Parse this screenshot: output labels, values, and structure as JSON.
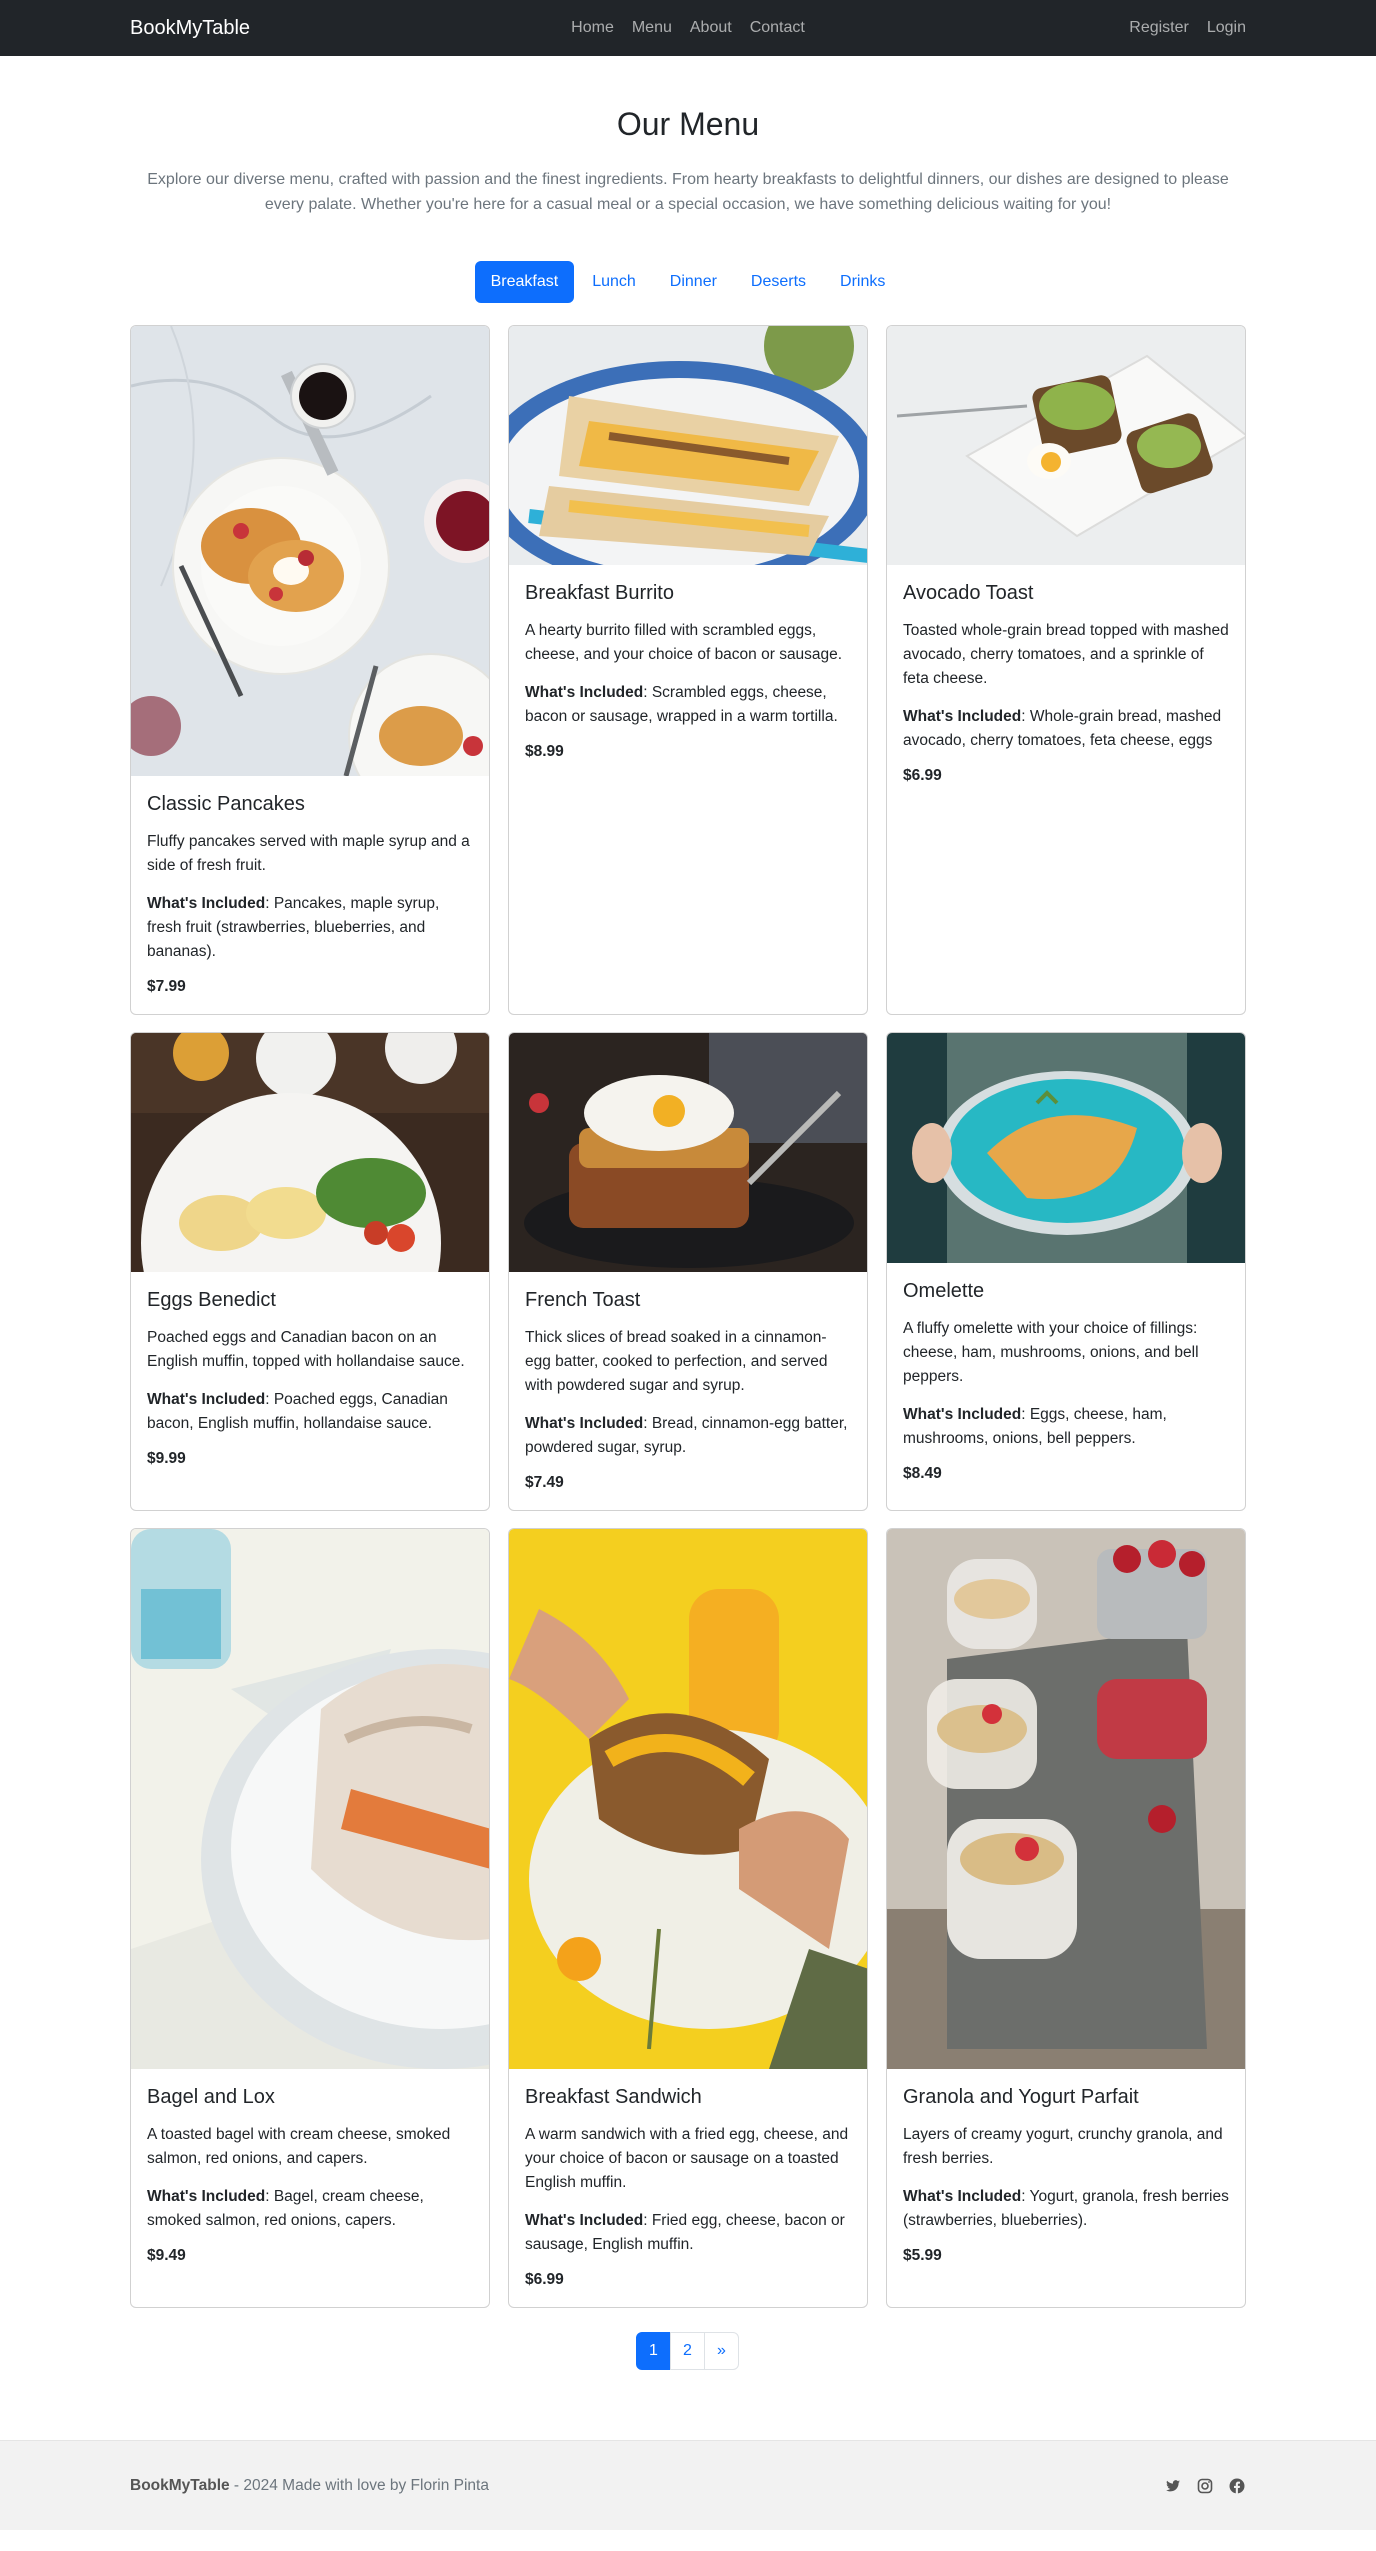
{
  "nav": {
    "brand": "BookMyTable",
    "links": [
      "Home",
      "Menu",
      "About",
      "Contact"
    ],
    "auth": [
      "Register",
      "Login"
    ]
  },
  "header": {
    "title": "Our Menu",
    "intro": "Explore our diverse menu, crafted with passion and the finest ingredients. From hearty breakfasts to delightful dinners, our dishes are designed to please every palate. Whether you're here for a casual meal or a special occasion, we have something delicious waiting for you!"
  },
  "tabs": [
    "Breakfast",
    "Lunch",
    "Dinner",
    "Deserts",
    "Drinks"
  ],
  "labels": {
    "included": "What's Included"
  },
  "items": [
    {
      "title": "Classic Pancakes",
      "desc": "Fluffy pancakes served with maple syrup and a side of fresh fruit.",
      "included": ": Pancakes, maple syrup, fresh fruit (strawberries, blueberries, and bananas).",
      "price": "$7.99"
    },
    {
      "title": "Breakfast Burrito",
      "desc": "A hearty burrito filled with scrambled eggs, cheese, and your choice of bacon or sausage.",
      "included": ": Scrambled eggs, cheese, bacon or sausage, wrapped in a warm tortilla.",
      "price": "$8.99"
    },
    {
      "title": "Avocado Toast",
      "desc": "Toasted whole-grain bread topped with mashed avocado, cherry tomatoes, and a sprinkle of feta cheese.",
      "included": ": Whole-grain bread, mashed avocado, cherry tomatoes, feta cheese, eggs",
      "price": "$6.99"
    },
    {
      "title": "Eggs Benedict",
      "desc": "Poached eggs and Canadian bacon on an English muffin, topped with hollandaise sauce.",
      "included": ": Poached eggs, Canadian bacon, English muffin, hollandaise sauce.",
      "price": "$9.99"
    },
    {
      "title": "French Toast",
      "desc": "Thick slices of bread soaked in a cinnamon-egg batter, cooked to perfection, and served with powdered sugar and syrup.",
      "included": ": Bread, cinnamon-egg batter, powdered sugar, syrup.",
      "price": "$7.49"
    },
    {
      "title": "Omelette",
      "desc": "A fluffy omelette with your choice of fillings: cheese, ham, mushrooms, onions, and bell peppers.",
      "included": ": Eggs, cheese, ham, mushrooms, onions, bell peppers.",
      "price": "$8.49"
    },
    {
      "title": "Bagel and Lox",
      "desc": "A toasted bagel with cream cheese, smoked salmon, red onions, and capers.",
      "included": ": Bagel, cream cheese, smoked salmon, red onions, capers.",
      "price": "$9.49"
    },
    {
      "title": "Breakfast Sandwich",
      "desc": "A warm sandwich with a fried egg, cheese, and your choice of bacon or sausage on a toasted English muffin.",
      "included": ": Fried egg, cheese, bacon or sausage, English muffin.",
      "price": "$6.99"
    },
    {
      "title": "Granola and Yogurt Parfait",
      "desc": "Layers of creamy yogurt, crunchy granola, and fresh berries.",
      "included": ": Yogurt, granola, fresh berries (strawberries, blueberries).",
      "price": "$5.99"
    }
  ],
  "pagination": [
    "1",
    "2",
    "»"
  ],
  "footer": {
    "brand": "BookMyTable",
    "text": " - 2024 Made with love by Florin Pinta",
    "icons": [
      "twitter-icon",
      "instagram-icon",
      "facebook-icon"
    ]
  },
  "colors": {
    "primary": "#0d6efd",
    "navbar": "#212529",
    "footer": "#f2f2f2"
  }
}
